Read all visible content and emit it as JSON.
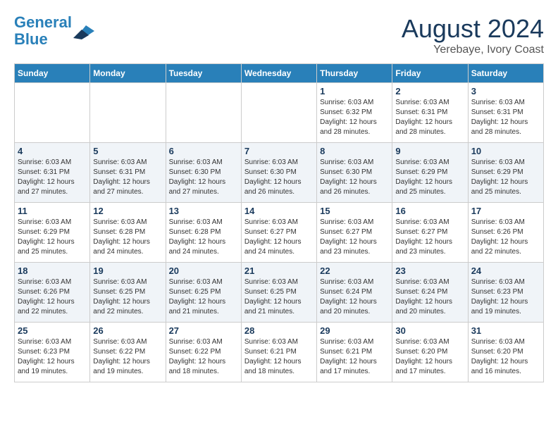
{
  "logo": {
    "line1": "General",
    "line2": "Blue"
  },
  "title": "August 2024",
  "location": "Yerebaye, Ivory Coast",
  "days_of_week": [
    "Sunday",
    "Monday",
    "Tuesday",
    "Wednesday",
    "Thursday",
    "Friday",
    "Saturday"
  ],
  "weeks": [
    [
      {
        "day": "",
        "info": ""
      },
      {
        "day": "",
        "info": ""
      },
      {
        "day": "",
        "info": ""
      },
      {
        "day": "",
        "info": ""
      },
      {
        "day": "1",
        "info": "Sunrise: 6:03 AM\nSunset: 6:32 PM\nDaylight: 12 hours\nand 28 minutes."
      },
      {
        "day": "2",
        "info": "Sunrise: 6:03 AM\nSunset: 6:31 PM\nDaylight: 12 hours\nand 28 minutes."
      },
      {
        "day": "3",
        "info": "Sunrise: 6:03 AM\nSunset: 6:31 PM\nDaylight: 12 hours\nand 28 minutes."
      }
    ],
    [
      {
        "day": "4",
        "info": "Sunrise: 6:03 AM\nSunset: 6:31 PM\nDaylight: 12 hours\nand 27 minutes."
      },
      {
        "day": "5",
        "info": "Sunrise: 6:03 AM\nSunset: 6:31 PM\nDaylight: 12 hours\nand 27 minutes."
      },
      {
        "day": "6",
        "info": "Sunrise: 6:03 AM\nSunset: 6:30 PM\nDaylight: 12 hours\nand 27 minutes."
      },
      {
        "day": "7",
        "info": "Sunrise: 6:03 AM\nSunset: 6:30 PM\nDaylight: 12 hours\nand 26 minutes."
      },
      {
        "day": "8",
        "info": "Sunrise: 6:03 AM\nSunset: 6:30 PM\nDaylight: 12 hours\nand 26 minutes."
      },
      {
        "day": "9",
        "info": "Sunrise: 6:03 AM\nSunset: 6:29 PM\nDaylight: 12 hours\nand 25 minutes."
      },
      {
        "day": "10",
        "info": "Sunrise: 6:03 AM\nSunset: 6:29 PM\nDaylight: 12 hours\nand 25 minutes."
      }
    ],
    [
      {
        "day": "11",
        "info": "Sunrise: 6:03 AM\nSunset: 6:29 PM\nDaylight: 12 hours\nand 25 minutes."
      },
      {
        "day": "12",
        "info": "Sunrise: 6:03 AM\nSunset: 6:28 PM\nDaylight: 12 hours\nand 24 minutes."
      },
      {
        "day": "13",
        "info": "Sunrise: 6:03 AM\nSunset: 6:28 PM\nDaylight: 12 hours\nand 24 minutes."
      },
      {
        "day": "14",
        "info": "Sunrise: 6:03 AM\nSunset: 6:27 PM\nDaylight: 12 hours\nand 24 minutes."
      },
      {
        "day": "15",
        "info": "Sunrise: 6:03 AM\nSunset: 6:27 PM\nDaylight: 12 hours\nand 23 minutes."
      },
      {
        "day": "16",
        "info": "Sunrise: 6:03 AM\nSunset: 6:27 PM\nDaylight: 12 hours\nand 23 minutes."
      },
      {
        "day": "17",
        "info": "Sunrise: 6:03 AM\nSunset: 6:26 PM\nDaylight: 12 hours\nand 22 minutes."
      }
    ],
    [
      {
        "day": "18",
        "info": "Sunrise: 6:03 AM\nSunset: 6:26 PM\nDaylight: 12 hours\nand 22 minutes."
      },
      {
        "day": "19",
        "info": "Sunrise: 6:03 AM\nSunset: 6:25 PM\nDaylight: 12 hours\nand 22 minutes."
      },
      {
        "day": "20",
        "info": "Sunrise: 6:03 AM\nSunset: 6:25 PM\nDaylight: 12 hours\nand 21 minutes."
      },
      {
        "day": "21",
        "info": "Sunrise: 6:03 AM\nSunset: 6:25 PM\nDaylight: 12 hours\nand 21 minutes."
      },
      {
        "day": "22",
        "info": "Sunrise: 6:03 AM\nSunset: 6:24 PM\nDaylight: 12 hours\nand 20 minutes."
      },
      {
        "day": "23",
        "info": "Sunrise: 6:03 AM\nSunset: 6:24 PM\nDaylight: 12 hours\nand 20 minutes."
      },
      {
        "day": "24",
        "info": "Sunrise: 6:03 AM\nSunset: 6:23 PM\nDaylight: 12 hours\nand 19 minutes."
      }
    ],
    [
      {
        "day": "25",
        "info": "Sunrise: 6:03 AM\nSunset: 6:23 PM\nDaylight: 12 hours\nand 19 minutes."
      },
      {
        "day": "26",
        "info": "Sunrise: 6:03 AM\nSunset: 6:22 PM\nDaylight: 12 hours\nand 19 minutes."
      },
      {
        "day": "27",
        "info": "Sunrise: 6:03 AM\nSunset: 6:22 PM\nDaylight: 12 hours\nand 18 minutes."
      },
      {
        "day": "28",
        "info": "Sunrise: 6:03 AM\nSunset: 6:21 PM\nDaylight: 12 hours\nand 18 minutes."
      },
      {
        "day": "29",
        "info": "Sunrise: 6:03 AM\nSunset: 6:21 PM\nDaylight: 12 hours\nand 17 minutes."
      },
      {
        "day": "30",
        "info": "Sunrise: 6:03 AM\nSunset: 6:20 PM\nDaylight: 12 hours\nand 17 minutes."
      },
      {
        "day": "31",
        "info": "Sunrise: 6:03 AM\nSunset: 6:20 PM\nDaylight: 12 hours\nand 16 minutes."
      }
    ]
  ]
}
